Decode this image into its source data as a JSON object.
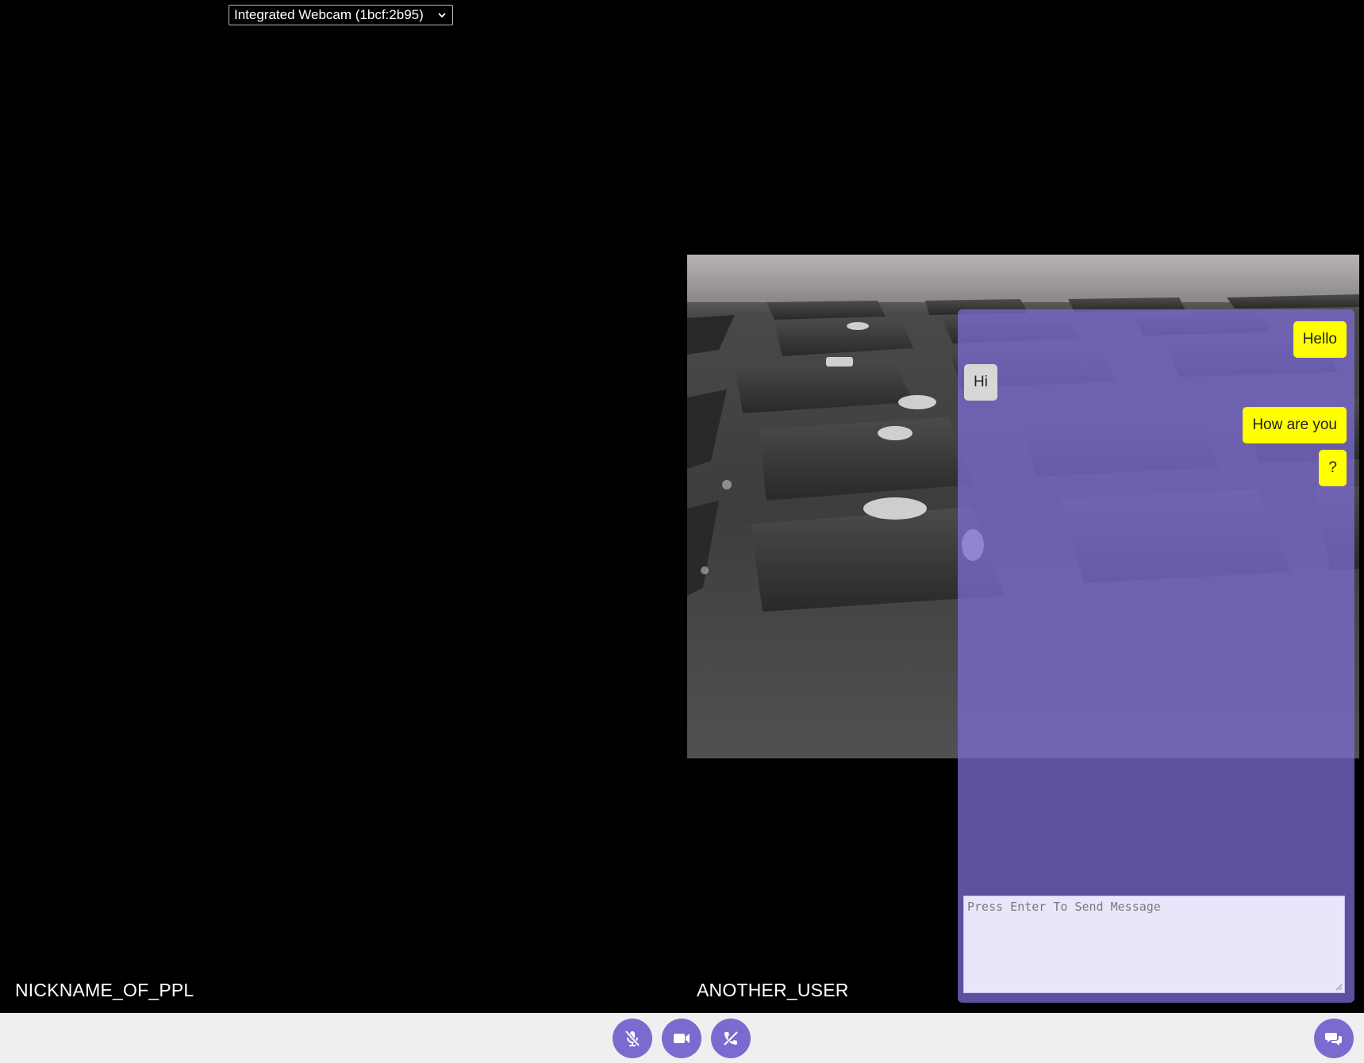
{
  "camera_select": {
    "selected": "Integrated Webcam (1bcf:2b95)"
  },
  "participants": {
    "local_name": "NICKNAME_OF_PPL",
    "remote_name": "ANOTHER_USER"
  },
  "chat": {
    "messages": [
      {
        "text": "Hello",
        "from": "me"
      },
      {
        "text": "Hi",
        "from": "other"
      },
      {
        "text": "How are you",
        "from": "me"
      },
      {
        "text": "?",
        "from": "me"
      }
    ],
    "input_placeholder": "Press Enter To Send Message"
  },
  "controls": {
    "buttons": [
      "mic-muted-icon",
      "video-camera-icon",
      "hang-up-icon"
    ],
    "chat_toggle": "chat-bubbles-icon"
  },
  "colors": {
    "accent": "#7a6bd0",
    "chat_panel": "#7c6cd4",
    "sent_bubble": "#ffff00",
    "received_bubble": "#d7d7d7",
    "bottom_bar": "#efefef"
  }
}
